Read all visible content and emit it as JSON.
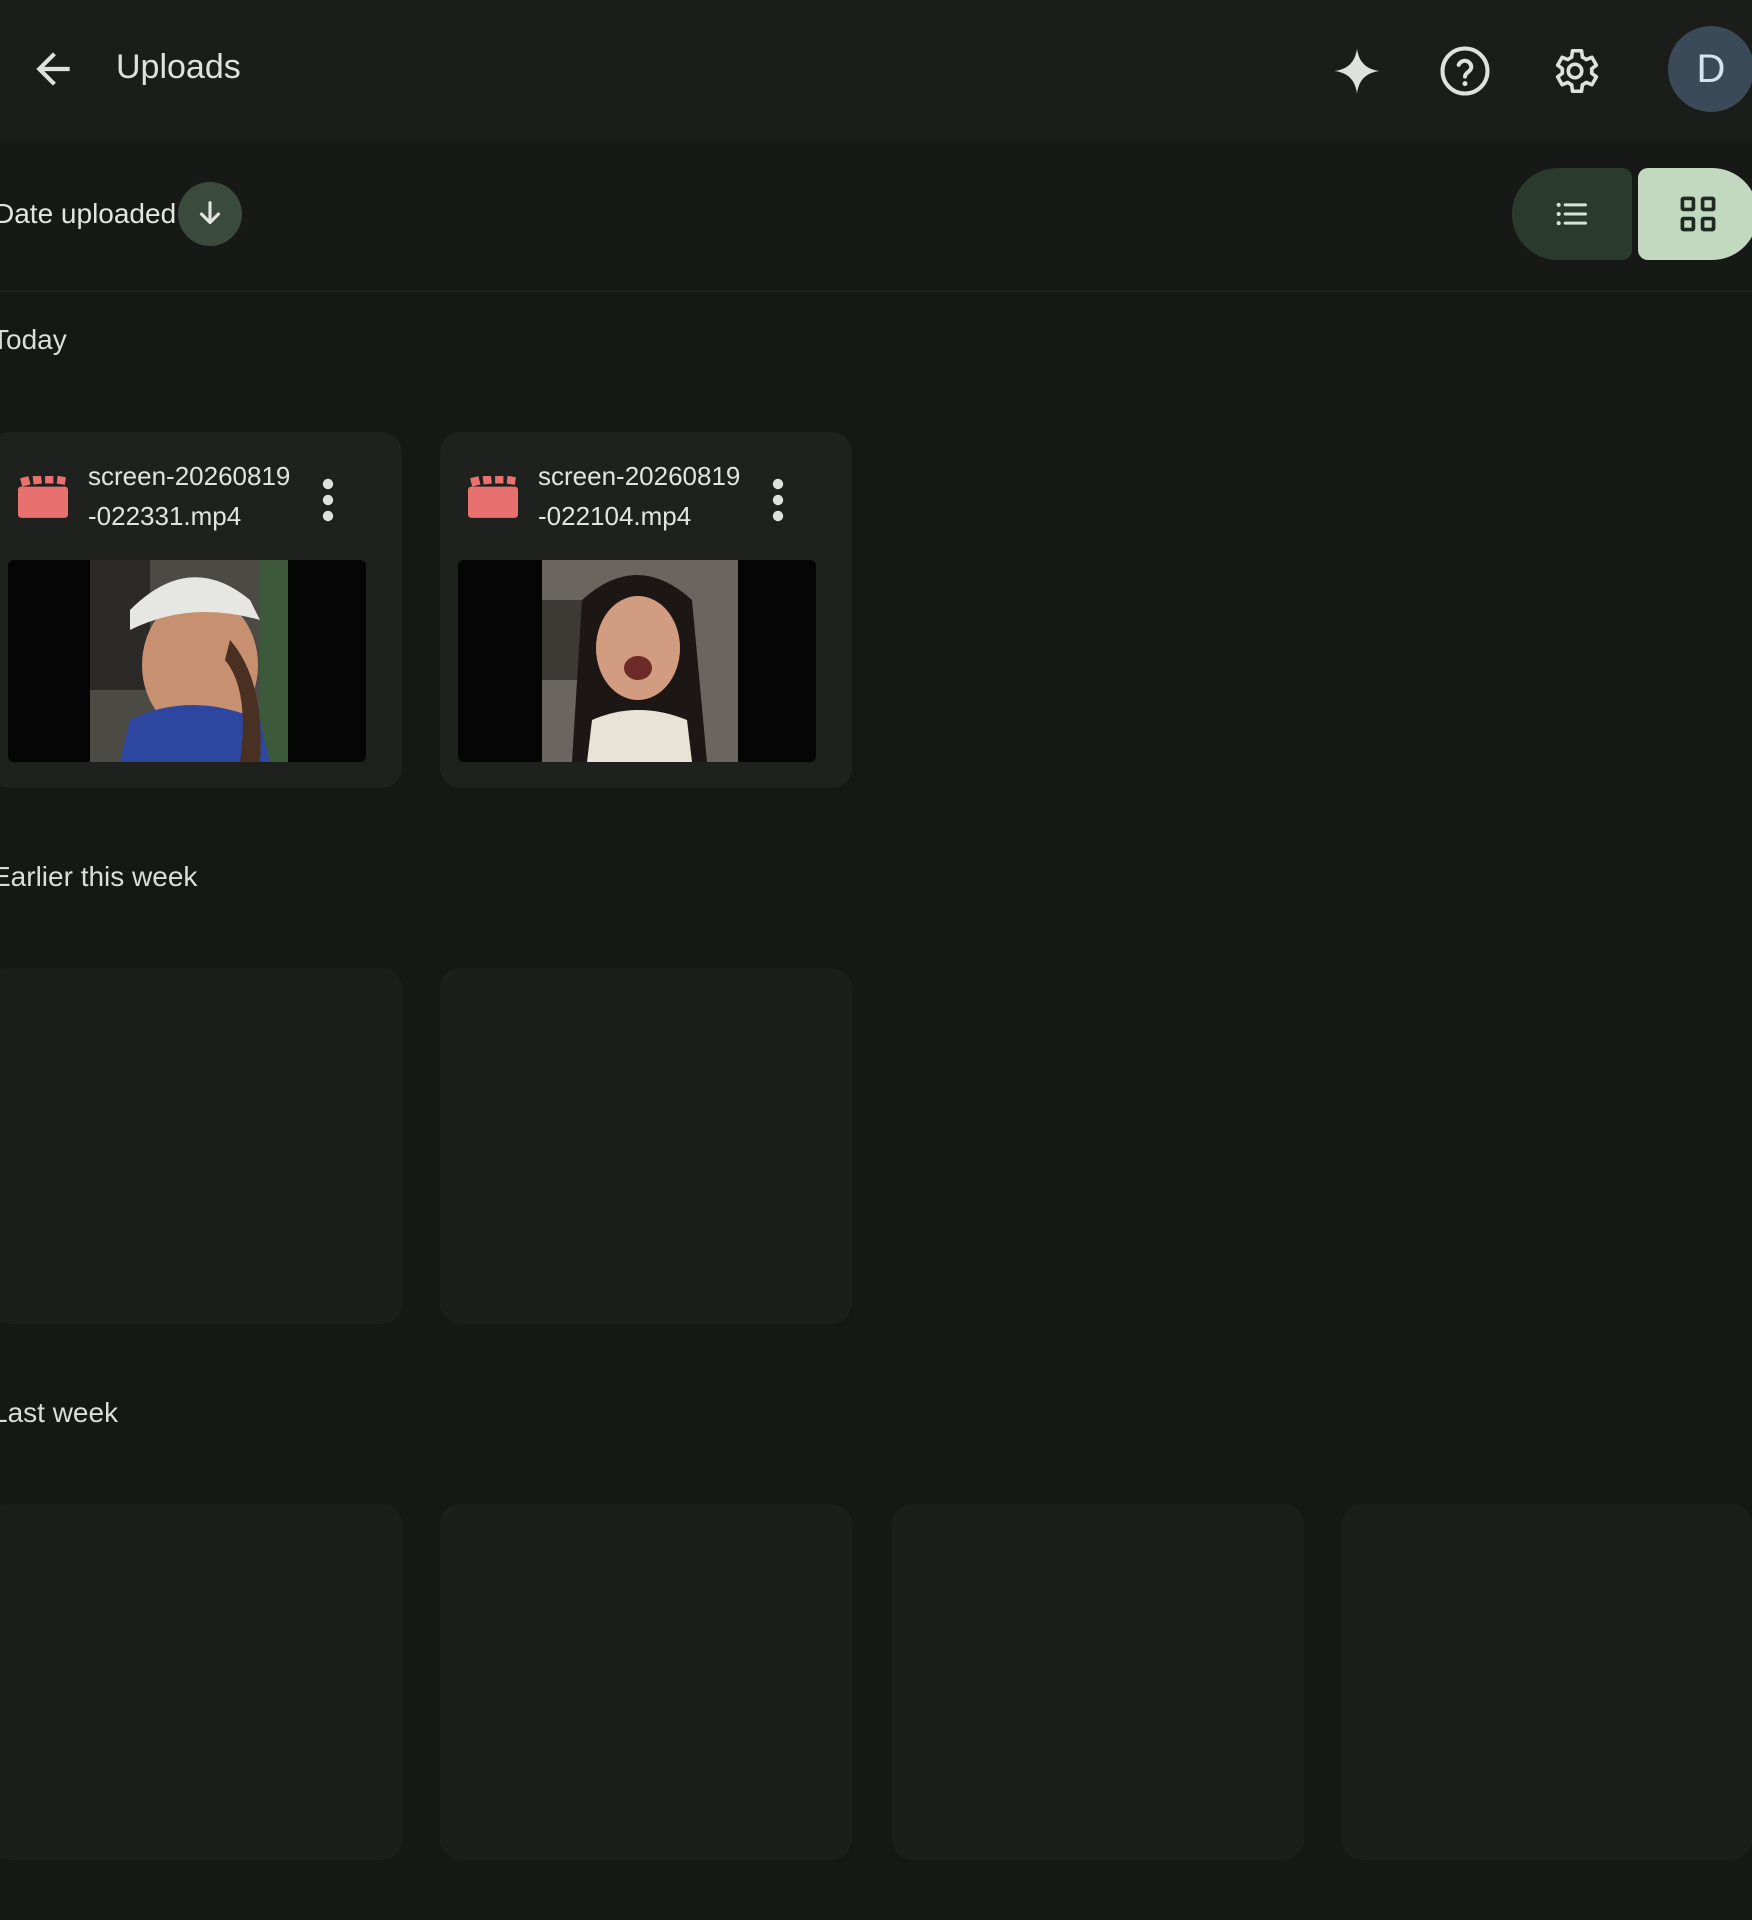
{
  "appbar": {
    "title": "Uploads",
    "icons": [
      "back-arrow-icon",
      "sparkle-icon",
      "help-icon",
      "gear-icon"
    ],
    "avatar_letter": "D"
  },
  "sortbar": {
    "label": "Date uploaded",
    "sort_icon": "arrow-down-icon",
    "views": [
      "list-view-icon",
      "grid-view-icon"
    ],
    "selected_view": "grid"
  },
  "sections": [
    {
      "label": "Today",
      "files": [
        {
          "name": "screen-20260819-022331.mp4",
          "type": "video"
        },
        {
          "name": "screen-20260819-022104.mp4",
          "type": "video"
        }
      ]
    },
    {
      "label": "Earlier this week"
    },
    {
      "label": "Last week"
    }
  ],
  "colors": {
    "background": "#161816",
    "card": "#1e211e",
    "video_icon": "#e8706f",
    "selected_view": "#c2d9c0"
  }
}
